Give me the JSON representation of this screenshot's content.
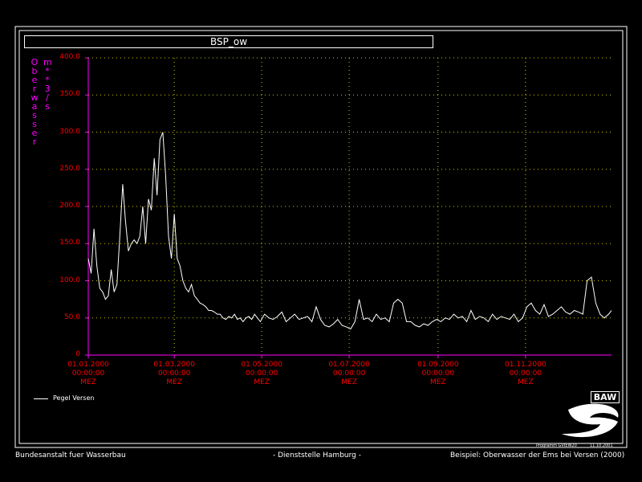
{
  "chart_data": {
    "type": "line",
    "title": "BSP_ow",
    "ylabel_main": "Oberwasser",
    "ylabel_unit": "m**3/s",
    "ylim": [
      0,
      400
    ],
    "yticks": [
      "400.0",
      "350.0",
      "300.0",
      "250.0",
      "200.0",
      "150.0",
      "100.0",
      "50.0",
      "0"
    ],
    "ytick_values": [
      400,
      350,
      300,
      250,
      200,
      150,
      100,
      50,
      0
    ],
    "xlim": [
      "2000-01-01",
      "2000-12-31"
    ],
    "xticks": [
      {
        "date": "2000-01-01",
        "label1": "01.01.2000",
        "label2": "00:00:00",
        "label3": "MEZ"
      },
      {
        "date": "2000-03-01",
        "label1": "01.03.2000",
        "label2": "00:00:00",
        "label3": "MEZ"
      },
      {
        "date": "2000-05-01",
        "label1": "01.05.2000",
        "label2": "00:00:00",
        "label3": "MEZ"
      },
      {
        "date": "2000-07-01",
        "label1": "01.07.2000",
        "label2": "00:00:00",
        "label3": "MEZ"
      },
      {
        "date": "2000-09-01",
        "label1": "01.09.2000",
        "label2": "00:00:00",
        "label3": "MEZ"
      },
      {
        "date": "2000-11-01",
        "label1": "01.11.2000",
        "label2": "00:00:00",
        "label3": "MEZ"
      }
    ],
    "grid": true,
    "legend_position": "bottom-left",
    "series": [
      {
        "name": "Pegel Versen",
        "color": "#ffffff",
        "x": [
          "2000-01-01",
          "2000-01-03",
          "2000-01-05",
          "2000-01-07",
          "2000-01-09",
          "2000-01-11",
          "2000-01-13",
          "2000-01-15",
          "2000-01-17",
          "2000-01-19",
          "2000-01-21",
          "2000-01-23",
          "2000-01-25",
          "2000-01-27",
          "2000-01-29",
          "2000-01-31",
          "2000-02-02",
          "2000-02-04",
          "2000-02-06",
          "2000-02-08",
          "2000-02-10",
          "2000-02-12",
          "2000-02-14",
          "2000-02-16",
          "2000-02-18",
          "2000-02-20",
          "2000-02-22",
          "2000-02-24",
          "2000-02-26",
          "2000-02-28",
          "2000-03-01",
          "2000-03-03",
          "2000-03-05",
          "2000-03-07",
          "2000-03-09",
          "2000-03-11",
          "2000-03-13",
          "2000-03-15",
          "2000-03-17",
          "2000-03-19",
          "2000-03-21",
          "2000-03-23",
          "2000-03-25",
          "2000-03-27",
          "2000-03-29",
          "2000-03-31",
          "2000-04-02",
          "2000-04-04",
          "2000-04-06",
          "2000-04-08",
          "2000-04-10",
          "2000-04-12",
          "2000-04-14",
          "2000-04-16",
          "2000-04-18",
          "2000-04-20",
          "2000-04-22",
          "2000-04-24",
          "2000-04-26",
          "2000-04-28",
          "2000-04-30",
          "2000-05-03",
          "2000-05-06",
          "2000-05-09",
          "2000-05-12",
          "2000-05-15",
          "2000-05-18",
          "2000-05-21",
          "2000-05-24",
          "2000-05-27",
          "2000-05-30",
          "2000-06-02",
          "2000-06-05",
          "2000-06-08",
          "2000-06-11",
          "2000-06-14",
          "2000-06-17",
          "2000-06-20",
          "2000-06-23",
          "2000-06-26",
          "2000-06-29",
          "2000-07-02",
          "2000-07-05",
          "2000-07-08",
          "2000-07-11",
          "2000-07-14",
          "2000-07-17",
          "2000-07-20",
          "2000-07-23",
          "2000-07-26",
          "2000-07-29",
          "2000-08-01",
          "2000-08-04",
          "2000-08-07",
          "2000-08-10",
          "2000-08-13",
          "2000-08-16",
          "2000-08-19",
          "2000-08-22",
          "2000-08-25",
          "2000-08-28",
          "2000-08-31",
          "2000-09-03",
          "2000-09-06",
          "2000-09-09",
          "2000-09-12",
          "2000-09-15",
          "2000-09-18",
          "2000-09-21",
          "2000-09-24",
          "2000-09-27",
          "2000-09-30",
          "2000-10-03",
          "2000-10-06",
          "2000-10-09",
          "2000-10-12",
          "2000-10-15",
          "2000-10-18",
          "2000-10-21",
          "2000-10-24",
          "2000-10-27",
          "2000-10-30",
          "2000-11-02",
          "2000-11-05",
          "2000-11-08",
          "2000-11-11",
          "2000-11-14",
          "2000-11-17",
          "2000-11-20",
          "2000-11-23",
          "2000-11-26",
          "2000-11-29",
          "2000-12-02",
          "2000-12-05",
          "2000-12-08",
          "2000-12-11",
          "2000-12-14",
          "2000-12-17",
          "2000-12-20",
          "2000-12-23",
          "2000-12-26",
          "2000-12-29",
          "2000-12-31"
        ],
        "values": [
          130,
          110,
          170,
          120,
          90,
          85,
          75,
          80,
          115,
          85,
          95,
          160,
          230,
          180,
          140,
          150,
          155,
          150,
          160,
          200,
          150,
          210,
          195,
          265,
          215,
          290,
          300,
          240,
          160,
          130,
          190,
          130,
          120,
          100,
          90,
          85,
          95,
          80,
          75,
          70,
          68,
          65,
          60,
          60,
          58,
          55,
          55,
          50,
          48,
          52,
          50,
          55,
          48,
          50,
          45,
          50,
          52,
          48,
          55,
          50,
          45,
          55,
          50,
          48,
          52,
          58,
          45,
          50,
          55,
          48,
          50,
          52,
          45,
          65,
          48,
          40,
          38,
          42,
          48,
          40,
          38,
          35,
          45,
          75,
          48,
          50,
          45,
          55,
          48,
          50,
          45,
          70,
          75,
          70,
          45,
          45,
          40,
          38,
          42,
          40,
          45,
          48,
          45,
          50,
          48,
          55,
          50,
          52,
          45,
          60,
          48,
          52,
          50,
          45,
          55,
          48,
          52,
          50,
          48,
          55,
          45,
          50,
          65,
          70,
          60,
          55,
          68,
          52,
          55,
          60,
          65,
          58,
          55,
          60,
          58,
          55,
          100,
          105,
          70,
          55,
          50,
          55,
          60
        ]
      }
    ]
  },
  "legend": {
    "label": "Pegel Versen"
  },
  "logo": {
    "text": "BAW"
  },
  "program": {
    "name": "Programm GVIEW20",
    "date": "11.10.2001"
  },
  "footer": {
    "left": "Bundesanstalt fuer Wasserbau",
    "center": "- Dienststelle Hamburg -",
    "right": "Beispiel: Oberwasser der Ems bei Versen (2000)"
  },
  "colors": {
    "axis": "#ff00ff",
    "tick_label": "#ff0000",
    "grid": "#cccc00",
    "line": "#ffffff",
    "frame": "#ffffff"
  }
}
